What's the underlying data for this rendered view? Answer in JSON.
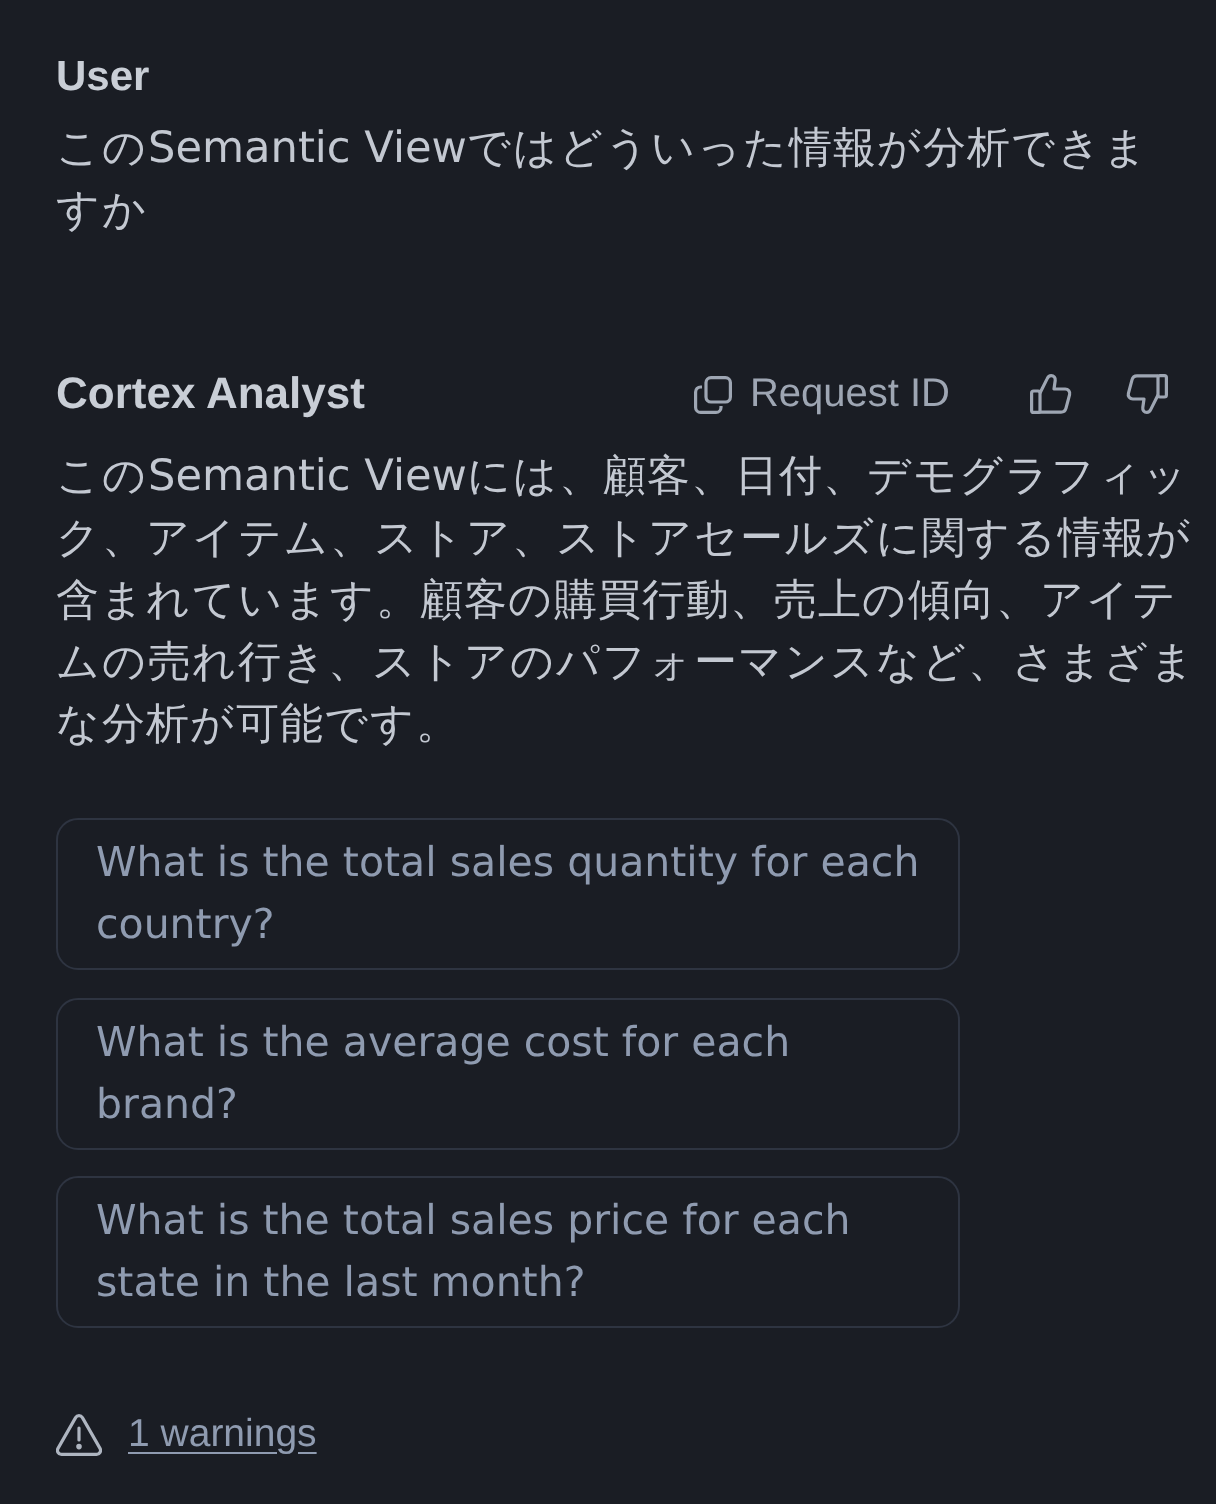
{
  "user_message": {
    "author": "User",
    "text": "このSemantic Viewではどういった情報が分析できますか"
  },
  "assistant_message": {
    "author": "Cortex Analyst",
    "request_id_button": "Request ID",
    "text": "このSemantic Viewには、顧客、日付、デモグラフィック、アイテム、ストア、ストアセールズに関する情報が含まれています。顧客の購買行動、売上の傾向、アイテムの売れ行き、ストアのパフォーマンスなど、さまざまな分析が可能です。",
    "suggestions": [
      "What is the total sales quantity for each country?",
      "What is the average cost for each brand?",
      "What is the total sales price for each state in the last month?"
    ],
    "warnings_link": "1 warnings"
  }
}
